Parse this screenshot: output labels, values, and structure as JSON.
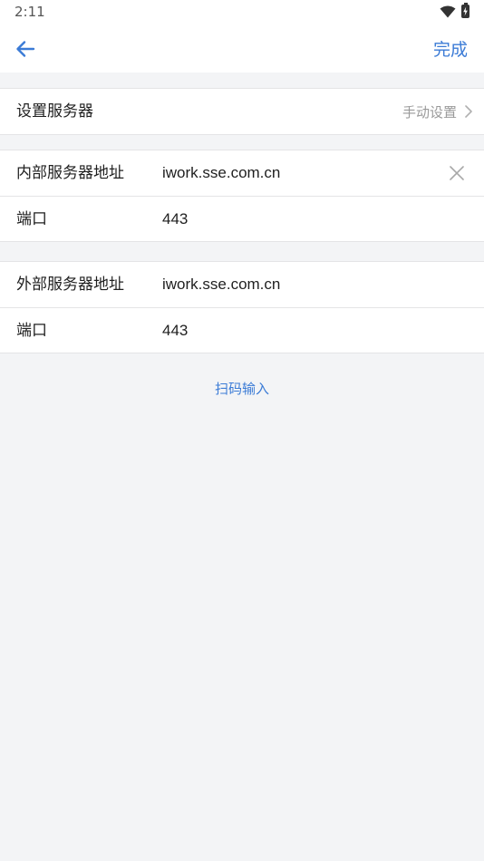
{
  "status_bar": {
    "time": "2:11"
  },
  "header": {
    "done_label": "完成"
  },
  "server_setting": {
    "label": "设置服务器",
    "mode": "手动设置"
  },
  "internal": {
    "address_label": "内部服务器地址",
    "address_value": "iwork.sse.com.cn",
    "port_label": "端口",
    "port_value": "443"
  },
  "external": {
    "address_label": "外部服务器地址",
    "address_value": "iwork.sse.com.cn",
    "port_label": "端口",
    "port_value": "443"
  },
  "scan": {
    "label": "扫码输入"
  },
  "colors": {
    "accent": "#3b7bd6",
    "background": "#f3f4f6",
    "divider": "#e4e4e6"
  }
}
